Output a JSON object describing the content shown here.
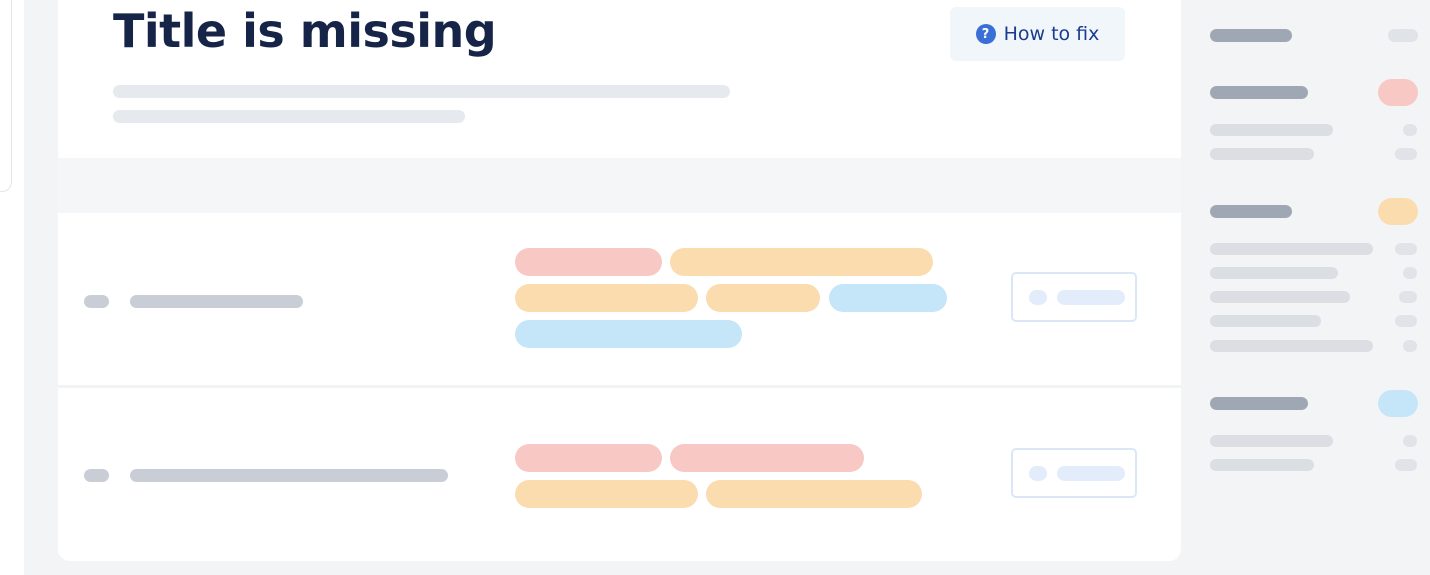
{
  "header": {
    "title": "Title is missing",
    "how_to_fix_label": "How to fix",
    "help_icon_glyph": "?"
  },
  "icons": {
    "help": "question-circle-icon"
  },
  "colors": {
    "title": "#162447",
    "how_to_fix_text": "#1a3c8c",
    "help_icon": "#3a6fd8",
    "severity_error": "#f8c8c4",
    "severity_warning": "#fbdcaf",
    "severity_notice": "#c5e6f9",
    "background": "#f3f4f6"
  },
  "rows": [
    {
      "tags": [
        "error",
        "warning",
        "warning",
        "warning",
        "notice",
        "notice"
      ]
    },
    {
      "tags": [
        "error",
        "error",
        "warning",
        "warning"
      ]
    }
  ],
  "sidebar": {
    "groups": [
      {
        "severity": "none"
      },
      {
        "severity": "error"
      },
      {
        "severity": "warning"
      },
      {
        "severity": "notice"
      }
    ]
  }
}
